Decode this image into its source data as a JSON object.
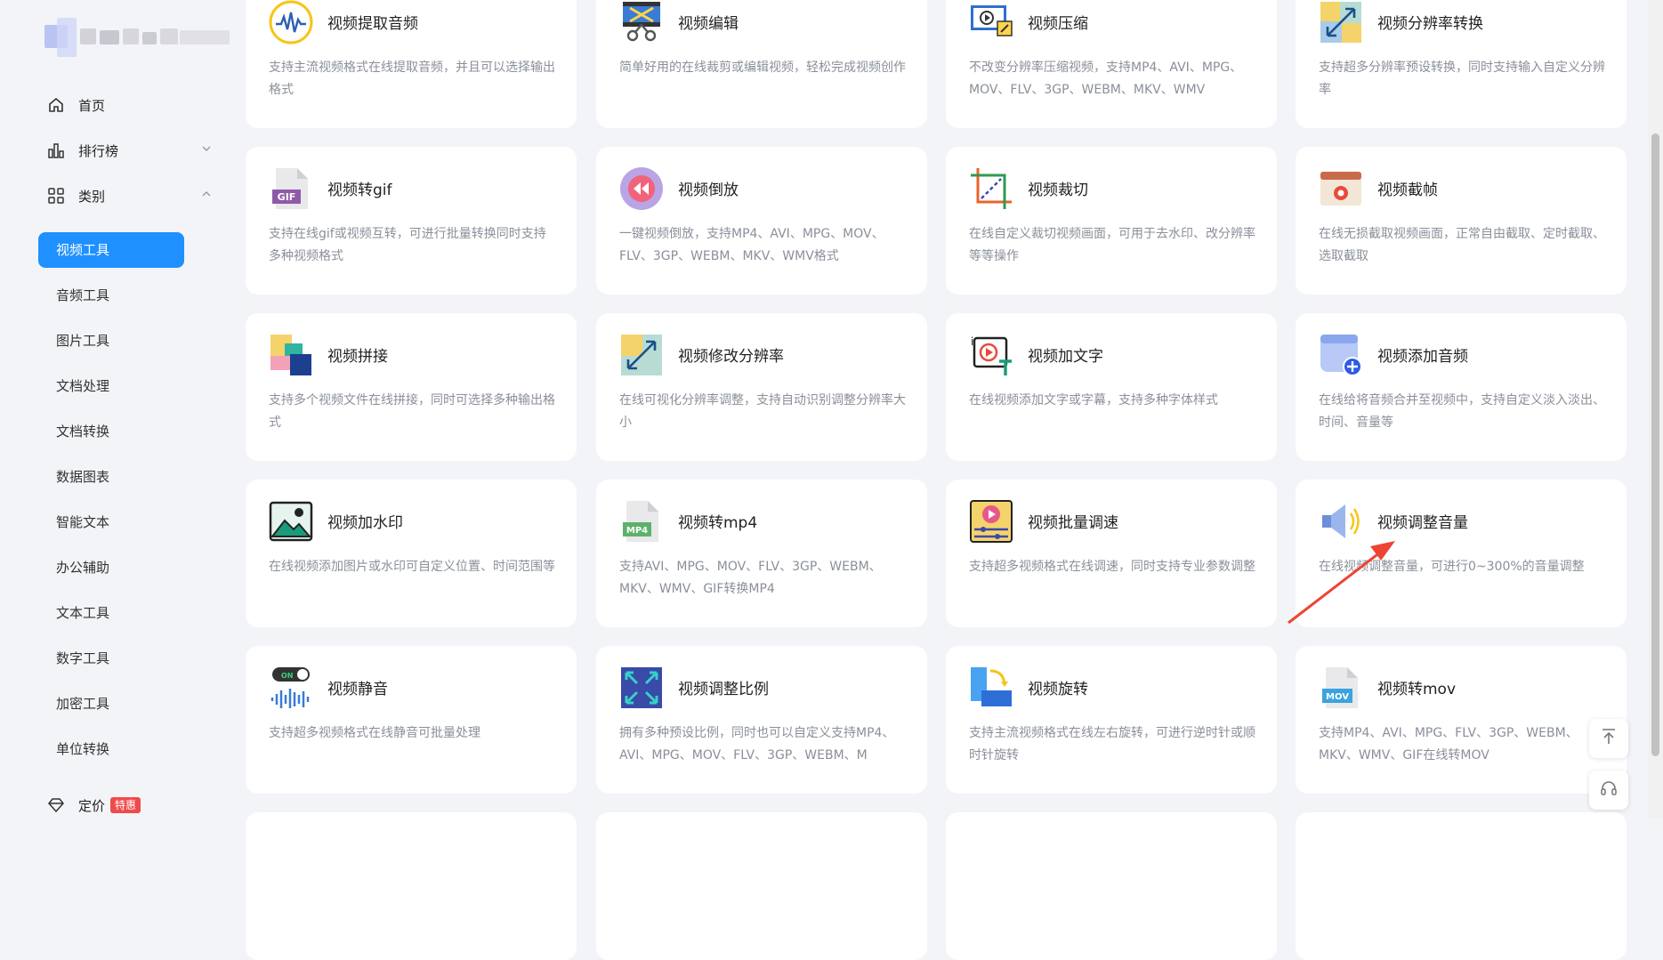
{
  "nav": {
    "home": "首页",
    "ranking": "排行榜",
    "category": "类别",
    "pricing": "定价",
    "pricing_badge": "特惠"
  },
  "subnav": [
    "视频工具",
    "音频工具",
    "图片工具",
    "文档处理",
    "文档转换",
    "数据图表",
    "智能文本",
    "办公辅助",
    "文本工具",
    "数字工具",
    "加密工具",
    "单位转换"
  ],
  "cards": [
    {
      "title": "视频提取音频",
      "desc": "支持主流视频格式在线提取音频，并且可以选择输出格式",
      "icon": "waveform-icon"
    },
    {
      "title": "视频编辑",
      "desc": "简单好用的在线裁剪或编辑视频，轻松完成视频创作",
      "icon": "film-scissors-icon"
    },
    {
      "title": "视频压缩",
      "desc": "不改变分辨率压缩视频，支持MP4、AVI、MPG、MOV、FLV、3GP、WEBM、MKV、WMV",
      "icon": "monitor-compress-icon"
    },
    {
      "title": "视频分辨率转换",
      "desc": "支持超多分辨率预设转换，同时支持输入自定义分辨率",
      "icon": "resize-diagonal-icon"
    },
    {
      "title": "视频转gif",
      "desc": "支持在线gif或视频互转，可进行批量转换同时支持多种视频格式",
      "icon": "gif-file-icon"
    },
    {
      "title": "视频倒放",
      "desc": "一键视频倒放，支持MP4、AVI、MPG、MOV、FLV、3GP、WEBM、MKV、WMV格式",
      "icon": "rewind-icon"
    },
    {
      "title": "视频裁切",
      "desc": "在线自定义裁切视频画面，可用于去水印、改分辨率等等操作",
      "icon": "crop-icon"
    },
    {
      "title": "视频截帧",
      "desc": "在线无损截取视频画面，正常自由截取、定时截取、选取截取",
      "icon": "camera-frame-icon"
    },
    {
      "title": "视频拼接",
      "desc": "支持多个视频文件在线拼接，同时可选择多种输出格式",
      "icon": "merge-blocks-icon"
    },
    {
      "title": "视频修改分辨率",
      "desc": "在线可视化分辨率调整，支持自动识别调整分辨率大小",
      "icon": "resolution-icon"
    },
    {
      "title": "视频加文字",
      "desc": "在线视频添加文字或字幕，支持多种字体样式",
      "icon": "video-text-icon"
    },
    {
      "title": "视频添加音频",
      "desc": "在线给将音频合并至视频中，支持自定义淡入淡出、时间、音量等",
      "icon": "add-audio-icon"
    },
    {
      "title": "视频加水印",
      "desc": "在线视频添加图片或水印可自定义位置、时间范围等",
      "icon": "image-watermark-icon"
    },
    {
      "title": "视频转mp4",
      "desc": "支持AVI、MPG、MOV、FLV、3GP、WEBM、MKV、WMV、GIF转换MP4",
      "icon": "mp4-file-icon"
    },
    {
      "title": "视频批量调速",
      "desc": "支持超多视频格式在线调速，同时支持专业参数调整",
      "icon": "speed-control-icon"
    },
    {
      "title": "视频调整音量",
      "desc": "在线视频调整音量，可进行0~300%的音量调整",
      "icon": "speaker-icon"
    },
    {
      "title": "视频静音",
      "desc": "支持超多视频格式在线静音可批量处理",
      "icon": "mute-toggle-icon"
    },
    {
      "title": "视频调整比例",
      "desc": "拥有多种预设比例，同时也可以自定义支持MP4、AVI、MPG、MOV、FLV、3GP、WEBM、M",
      "icon": "aspect-ratio-icon"
    },
    {
      "title": "视频旋转",
      "desc": "支持主流视频格式在线左右旋转，可进行逆时针或顺时针旋转",
      "icon": "rotate-icon"
    },
    {
      "title": "视频转mov",
      "desc": "支持MP4、AVI、MPG、FLV、3GP、WEBM、MKV、WMV、GIF在线转MOV",
      "icon": "mov-file-icon"
    }
  ]
}
